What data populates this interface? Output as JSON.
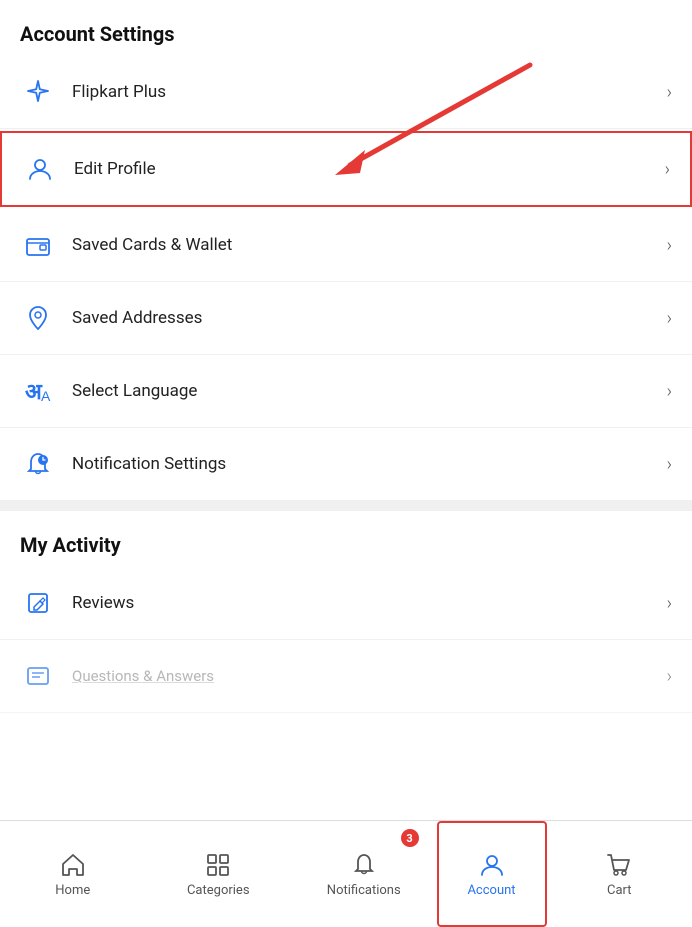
{
  "page": {
    "title": "Account Settings"
  },
  "accountSettings": {
    "title": "Account Settings",
    "items": [
      {
        "id": "flipkart-plus",
        "label": "Flipkart Plus",
        "icon": "sparkle-icon",
        "highlighted": false
      },
      {
        "id": "edit-profile",
        "label": "Edit Profile",
        "icon": "user-icon",
        "highlighted": true
      },
      {
        "id": "saved-cards",
        "label": "Saved Cards & Wallet",
        "icon": "wallet-icon",
        "highlighted": false
      },
      {
        "id": "saved-addresses",
        "label": "Saved Addresses",
        "icon": "location-icon",
        "highlighted": false
      },
      {
        "id": "select-language",
        "label": "Select Language",
        "icon": "language-icon",
        "highlighted": false
      },
      {
        "id": "notification-settings",
        "label": "Notification Settings",
        "icon": "notification-settings-icon",
        "highlighted": false
      }
    ]
  },
  "myActivity": {
    "title": "My Activity",
    "items": [
      {
        "id": "reviews",
        "label": "Reviews",
        "icon": "edit-icon"
      },
      {
        "id": "questions-answers",
        "label": "Questions & Answers",
        "icon": "qa-icon"
      }
    ]
  },
  "bottomNav": {
    "items": [
      {
        "id": "home",
        "label": "Home",
        "icon": "home-icon",
        "active": false
      },
      {
        "id": "categories",
        "label": "Categories",
        "icon": "categories-icon",
        "active": false
      },
      {
        "id": "notifications",
        "label": "Notifications",
        "icon": "bell-icon",
        "active": false,
        "badge": "3"
      },
      {
        "id": "account",
        "label": "Account",
        "icon": "account-icon",
        "active": true
      },
      {
        "id": "cart",
        "label": "Cart",
        "icon": "cart-icon",
        "active": false
      }
    ]
  }
}
